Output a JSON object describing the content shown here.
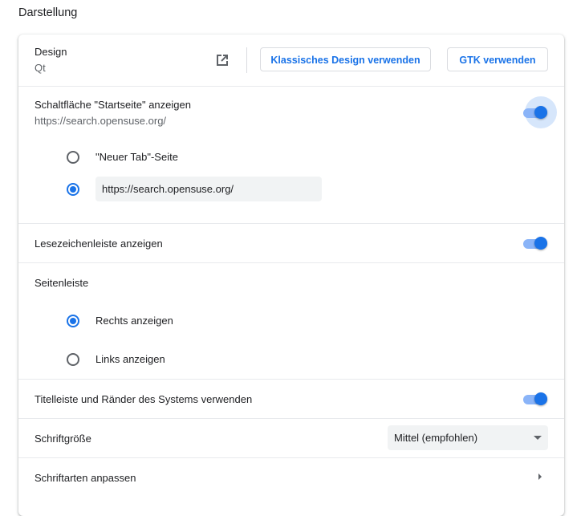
{
  "section_title": "Darstellung",
  "design": {
    "label": "Design",
    "value": "Qt",
    "icon": "open-in-new-icon",
    "classic_button": "Klassisches Design verwenden",
    "gtk_button": "GTK verwenden"
  },
  "home_button": {
    "label": "Schaltfläche \"Startseite\" anzeigen",
    "value": "https://search.opensuse.org/",
    "enabled": true,
    "options": [
      {
        "label": "\"Neuer Tab\"-Seite",
        "checked": false
      },
      {
        "label": "",
        "checked": true
      }
    ],
    "custom_url": "https://search.opensuse.org/"
  },
  "bookmarks_bar": {
    "label": "Lesezeichenleiste anzeigen",
    "enabled": true
  },
  "side_panel": {
    "label": "Seitenleiste",
    "options": [
      {
        "label": "Rechts anzeigen",
        "checked": true
      },
      {
        "label": "Links anzeigen",
        "checked": false
      }
    ]
  },
  "system_titlebar": {
    "label": "Titelleiste und Ränder des Systems verwenden",
    "enabled": true
  },
  "font_size": {
    "label": "Schriftgröße",
    "selected": "Mittel (empfohlen)"
  },
  "customize_fonts": {
    "label": "Schriftarten anpassen"
  },
  "colors": {
    "accent": "#1a73e8",
    "toggle_track": "#8ab4f8"
  }
}
